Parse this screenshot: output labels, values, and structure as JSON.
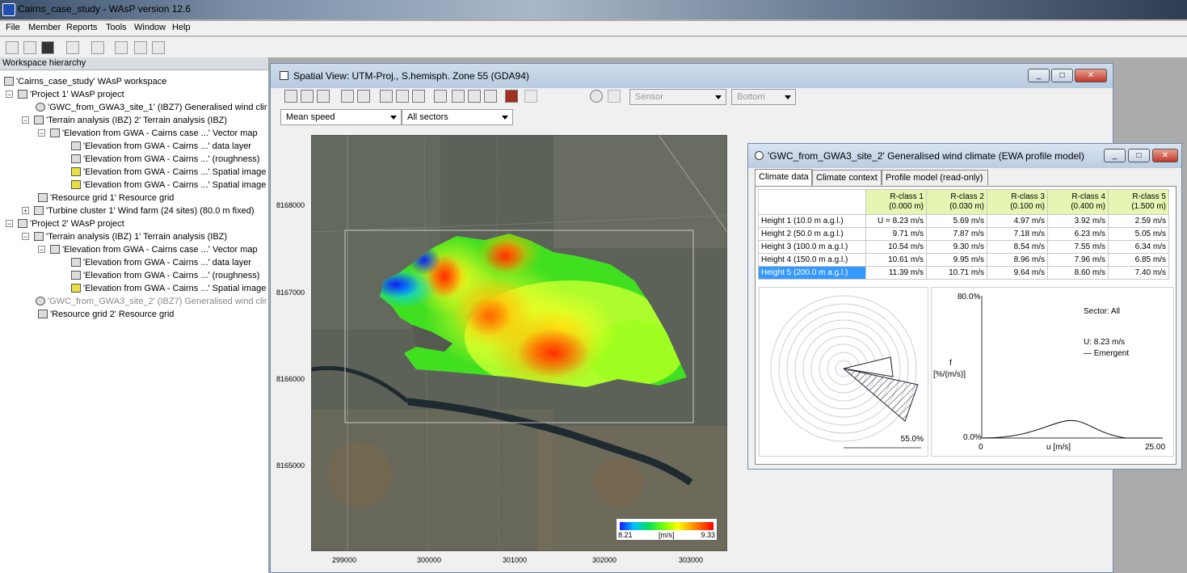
{
  "app": {
    "title": "Cairns_case_study - WAsP version 12.6"
  },
  "menu": [
    "File",
    "Member",
    "Reports",
    "Tools",
    "Window",
    "Help"
  ],
  "workspace": {
    "header": "Workspace hierarchy",
    "items": [
      {
        "text": "'Cairns_case_study' WAsP workspace"
      },
      {
        "text": "'Project 1' WAsP project"
      },
      {
        "text": "'GWC_from_GWA3_site_1' (IBZ7) Generalised wind clir"
      },
      {
        "text": "'Terrain analysis (IBZ) 2' Terrain analysis (IBZ)"
      },
      {
        "text": "'Elevation from GWA - Cairns case ...' Vector map"
      },
      {
        "text": "'Elevation from GWA - Cairns ...' data layer"
      },
      {
        "text": "'Elevation from GWA - Cairns ...' (roughness)"
      },
      {
        "text": "'Elevation from GWA - Cairns ...' Spatial image"
      },
      {
        "text": "'Elevation from GWA - Cairns ...' Spatial image"
      },
      {
        "text": "'Resource grid 1' Resource grid"
      },
      {
        "text": "'Turbine cluster 1' Wind farm (24 sites) (80.0 m fixed)"
      },
      {
        "text": "'Project 2' WAsP project"
      },
      {
        "text": "'Terrain analysis (IBZ) 1' Terrain analysis (IBZ)"
      },
      {
        "text": "'Elevation from GWA - Cairns case ...' Vector map"
      },
      {
        "text": "'Elevation from GWA - Cairns ...' data layer"
      },
      {
        "text": "'Elevation from GWA - Cairns ...' (roughness)"
      },
      {
        "text": "'Elevation from GWA - Cairns ...' Spatial image"
      },
      {
        "text": "'GWC_from_GWA3_site_2' (IBZ7) Generalised wind clir"
      },
      {
        "text": "'Resource grid 2' Resource grid"
      }
    ]
  },
  "spatial_view": {
    "title": "Spatial View: UTM-Proj., S.hemisph. Zone 55 (GDA94)",
    "variable": "Mean speed",
    "sectors": "All sectors",
    "combo3": "Sensor",
    "combo4": "Bottom",
    "y_ticks": [
      "8168000",
      "8167000",
      "8166000",
      "8165000"
    ],
    "x_ticks": [
      "299000",
      "300000",
      "301000",
      "302000",
      "303000"
    ],
    "legend": {
      "min": "8.21",
      "unit": "[m/s]",
      "max": "9.33"
    }
  },
  "gwc": {
    "title": "'GWC_from_GWA3_site_2' Generalised wind climate (EWA profile model)",
    "tabs": [
      "Climate data",
      "Climate context",
      "Profile model (read-only)"
    ],
    "columns": [
      {
        "name": "R-class 1",
        "sub": "(0.000 m)"
      },
      {
        "name": "R-class 2",
        "sub": "(0.030 m)"
      },
      {
        "name": "R-class 3",
        "sub": "(0.100 m)"
      },
      {
        "name": "R-class 4",
        "sub": "(0.400 m)"
      },
      {
        "name": "R-class 5",
        "sub": "(1.500 m)"
      }
    ],
    "rows": [
      {
        "label": "Height 1  (10.0 m a.g.l.)",
        "values": [
          "U = 8.23 m/s",
          "5.69 m/s",
          "4.97 m/s",
          "3.92 m/s",
          "2.59 m/s"
        ]
      },
      {
        "label": "Height 2  (50.0 m a.g.l.)",
        "values": [
          "9.71 m/s",
          "7.87 m/s",
          "7.18 m/s",
          "6.23 m/s",
          "5.05 m/s"
        ]
      },
      {
        "label": "Height 3  (100.0 m a.g.l.)",
        "values": [
          "10.54 m/s",
          "9.30 m/s",
          "8.54 m/s",
          "7.55 m/s",
          "6.34 m/s"
        ]
      },
      {
        "label": "Height 4  (150.0 m a.g.l.)",
        "values": [
          "10.61 m/s",
          "9.95 m/s",
          "8.96 m/s",
          "7.96 m/s",
          "6.85 m/s"
        ]
      },
      {
        "label": "Height 5  (200.0 m a.g.l.)",
        "values": [
          "11.39 m/s",
          "10.71 m/s",
          "9.64 m/s",
          "8.60 m/s",
          "7.40 m/s"
        ]
      }
    ],
    "rose_label": "55.0%",
    "dist": {
      "ymax": "80.0%",
      "ymin": "0.0%",
      "xmin": "0",
      "xmax": "25.00",
      "xlabel": "u [m/s]",
      "ylabel1": "f",
      "ylabel2": "[%/(m/s)]",
      "sector": "Sector: All",
      "u": "U: 8.23 m/s",
      "emergent": "— Emergent"
    }
  },
  "colors": {
    "accent": "#3399ff",
    "header_green": "#e6f5b2"
  }
}
